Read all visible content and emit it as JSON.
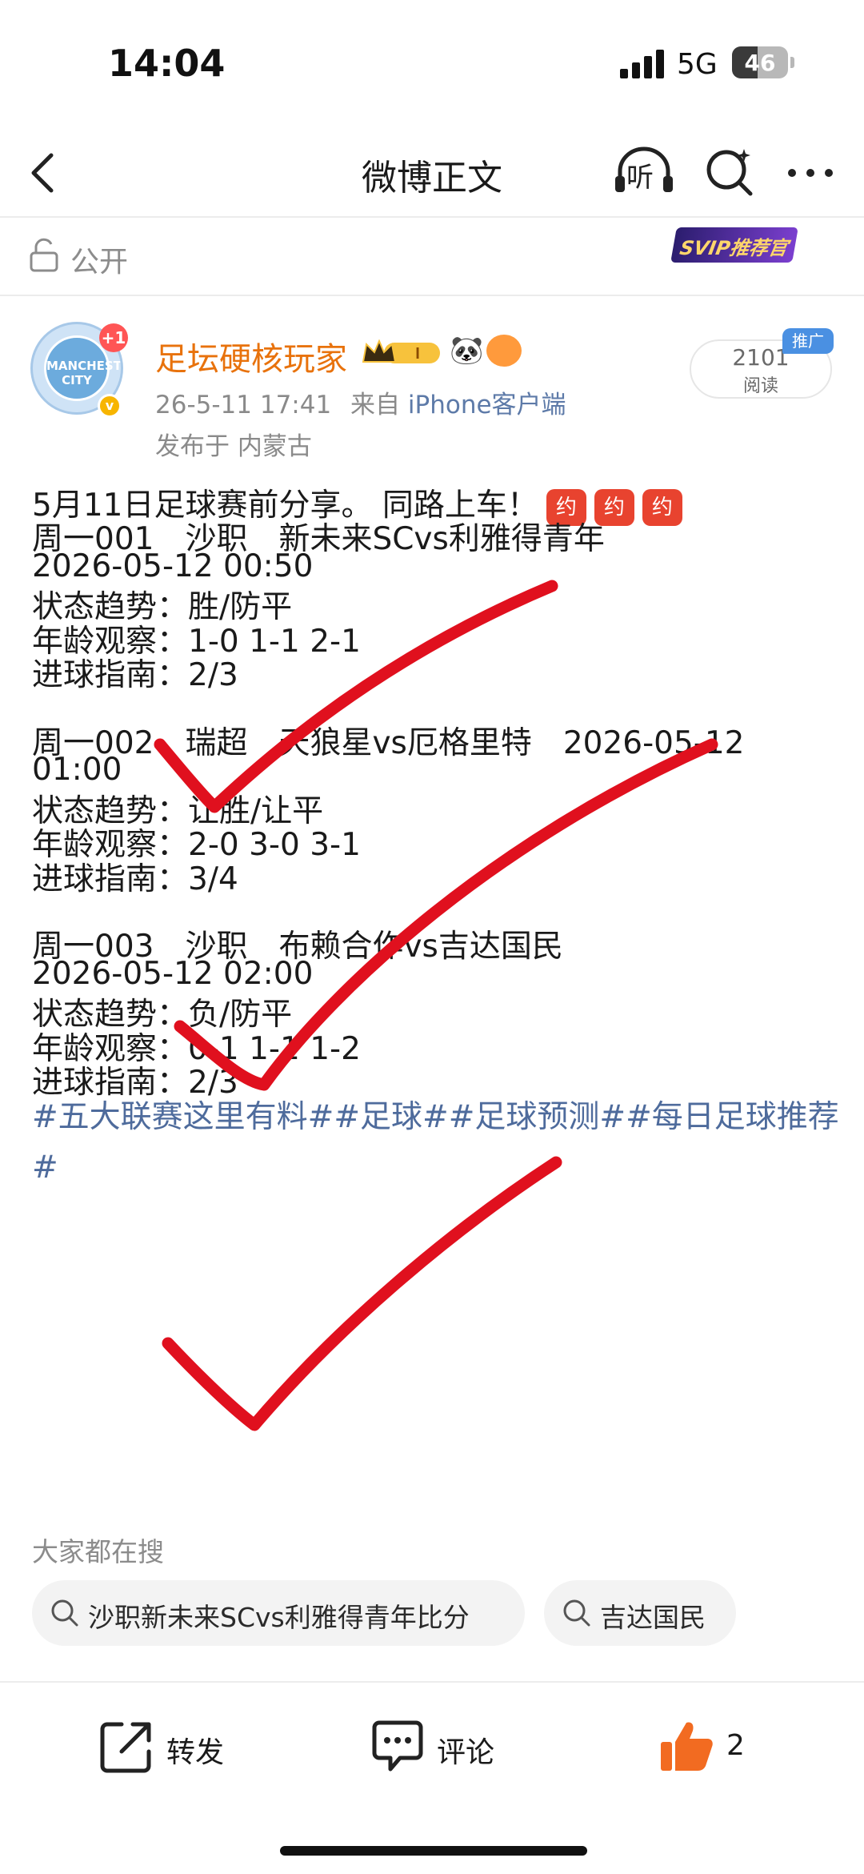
{
  "status_bar": {
    "time": "14:04",
    "network": "5G",
    "battery": "46",
    "battery_level": 0.46
  },
  "nav": {
    "title": "微博正文",
    "listen_label": "听"
  },
  "visibility": {
    "label": "公开",
    "badge": "SVIP推荐官"
  },
  "author": {
    "name": "足坛硬核玩家",
    "avatar_text": "MANCHESTER CITY",
    "avatar_badge": "+1",
    "vip_level": "I",
    "date": "26-5-11 17:41",
    "source_prefix": "来自",
    "source": "iPhone客户端",
    "location": "发布于 内蒙古"
  },
  "stats": {
    "reads": "2101",
    "reads_label": "阅读",
    "promo_tag": "推广"
  },
  "post": {
    "intro": "5月11日足球赛前分享。 同路上车！",
    "intro_emoji": "约",
    "matches": [
      {
        "header": "周一001　沙职　新未来SCvs利雅得青年",
        "time": " 2026-05-12 00:50",
        "trend": "状态趋势：胜/防平",
        "age": "年龄观察：1-0 1-1 2-1",
        "goals": "进球指南：2/3"
      },
      {
        "header": "周一002　瑞超　天狼星vs厄格里特　2026-05-12",
        "time": "01:00",
        "trend": "状态趋势：让胜/让平",
        "age": "年龄观察：2-0 3-0 3-1",
        "goals": "进球指南：3/4"
      },
      {
        "header": "周一003　沙职　布赖合作vs吉达国民",
        "time": " 2026-05-12 02:00",
        "trend": "状态趋势：负/防平",
        "age": "年龄观察：0-1 1-1 1-2",
        "goals": "进球指南：2/3"
      }
    ],
    "hashtags": "#五大联赛这里有料##足球##足球预测##每日足球推荐#"
  },
  "search": {
    "title": "大家都在搜",
    "chips": [
      "沙职新未来SCvs利雅得青年比分",
      "吉达国民"
    ]
  },
  "actions": {
    "repost": "转发",
    "comment": "评论",
    "likes": "2"
  },
  "colors": {
    "author_name": "#e8720c",
    "hashtag": "#4e6b9c",
    "checkmark": "#e0101e",
    "like": "#f26b21"
  }
}
